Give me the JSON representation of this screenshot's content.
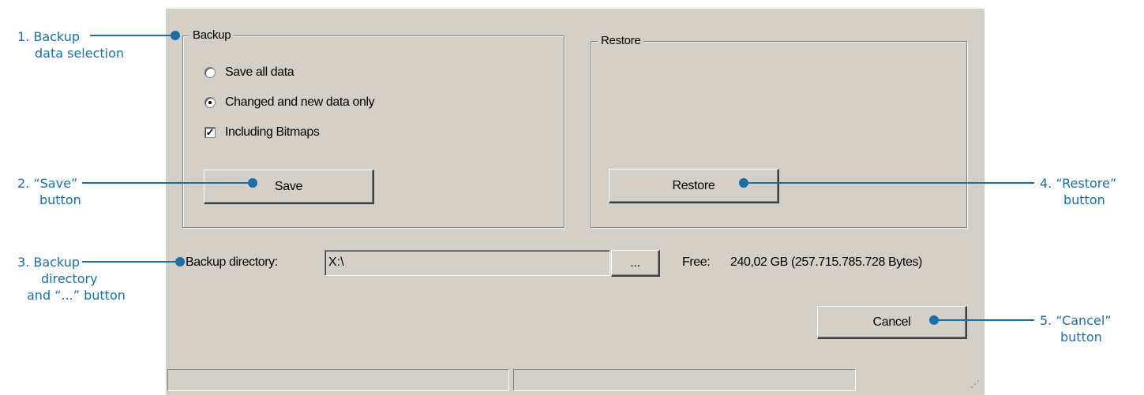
{
  "backup_group": {
    "title": "Backup",
    "options": [
      {
        "type": "radio",
        "label": "Save all data",
        "checked": false
      },
      {
        "type": "radio",
        "label": "Changed and new data only",
        "checked": true
      },
      {
        "type": "checkbox",
        "label": "Including Bitmaps",
        "checked": true
      }
    ],
    "save_label": "Save"
  },
  "restore_group": {
    "title": "Restore",
    "restore_label": "Restore"
  },
  "directory": {
    "label": "Backup directory:",
    "value": "X:\\",
    "browse_label": "...",
    "free_label": "Free:",
    "free_value": "240,02 GB (257.715.785.728 Bytes)"
  },
  "cancel_label": "Cancel",
  "annotations": {
    "a1": [
      "1. Backup",
      "data selection"
    ],
    "a2": [
      "2. “Save”",
      "button"
    ],
    "a3": [
      "3. Backup",
      "directory",
      "and “...” button"
    ],
    "a4": [
      "4. “Restore”",
      "button"
    ],
    "a5": [
      "5. “Cancel”",
      "button"
    ]
  },
  "colors": {
    "accent": "#1a6fa8",
    "dialog_bg": "#d4d0c8"
  }
}
